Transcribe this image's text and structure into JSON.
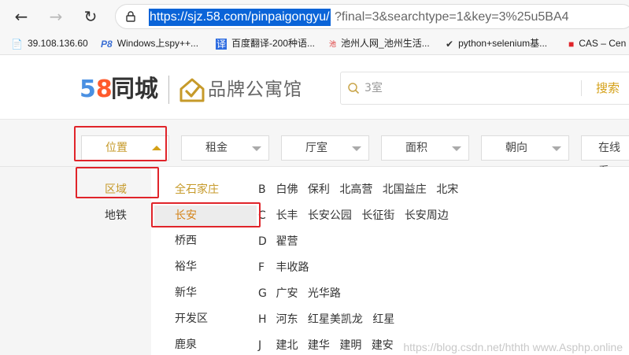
{
  "browser": {
    "url_selected": "https://sjz.58.com/pinpaigongyu/",
    "url_rest": "?final=3&searchtype=1&key=3%25u5BA4",
    "bookmarks": [
      {
        "icon": "page-icon",
        "label": "39.108.136.60"
      },
      {
        "icon": "p8-icon",
        "label": "Windows上spy++..."
      },
      {
        "icon": "translate-icon",
        "label": "百度翻译-200种语..."
      },
      {
        "icon": "site-icon",
        "label": "池州人网_池州生活..."
      },
      {
        "icon": "python-icon",
        "label": "python+selenium基..."
      },
      {
        "icon": "cas-icon",
        "label": "CAS – Cen"
      }
    ]
  },
  "header": {
    "logo_digit5": "5",
    "logo_digit8": "8",
    "logo_text": "同城",
    "brand_text": "品牌公寓馆",
    "search_placeholder": "3室",
    "search_button": "搜索"
  },
  "filters": [
    {
      "label": "位置",
      "active": true
    },
    {
      "label": "租金",
      "active": false
    },
    {
      "label": "厅室",
      "active": false
    },
    {
      "label": "面积",
      "active": false
    },
    {
      "label": "朝向",
      "active": false
    },
    {
      "label": "在线看",
      "active": false
    }
  ],
  "location_types": [
    {
      "label": "区域",
      "active": true
    },
    {
      "label": "地铁",
      "active": false
    }
  ],
  "districts": [
    {
      "label": "全石家庄",
      "state": "gold"
    },
    {
      "label": "长安",
      "state": "highlight"
    },
    {
      "label": "桥西",
      "state": "normal"
    },
    {
      "label": "裕华",
      "state": "normal"
    },
    {
      "label": "新华",
      "state": "normal"
    },
    {
      "label": "开发区",
      "state": "normal"
    },
    {
      "label": "鹿泉",
      "state": "normal"
    }
  ],
  "neighborhood_rows": [
    {
      "letter": "B",
      "items": [
        "白佛",
        "保利",
        "北高营",
        "北国益庄",
        "北宋"
      ]
    },
    {
      "letter": "C",
      "items": [
        "长丰",
        "长安公园",
        "长征街",
        "长安周边"
      ]
    },
    {
      "letter": "D",
      "items": [
        "翟营"
      ]
    },
    {
      "letter": "F",
      "items": [
        "丰收路"
      ]
    },
    {
      "letter": "G",
      "items": [
        "广安",
        "光华路"
      ]
    },
    {
      "letter": "H",
      "items": [
        "河东",
        "红星美凯龙",
        "红星"
      ]
    },
    {
      "letter": "J",
      "items": [
        "建北",
        "建华",
        "建明",
        "建安"
      ]
    }
  ],
  "watermark": "https://blog.csdn.net/hthth www.Asphp.online",
  "colors": {
    "accent_gold": "#c69a2a",
    "annotation_red": "#e0242a",
    "selection_blue": "#0a64d8"
  }
}
